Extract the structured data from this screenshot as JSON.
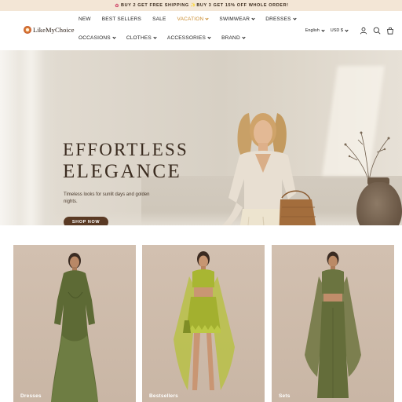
{
  "announcement": {
    "text": "BUY 2 GET FREE SHIPPING ✨BUY 3 GET 15% OFF WHOLE ORDER!",
    "icon": "gift-icon"
  },
  "brand": {
    "name": "LikeMyChoice",
    "logo_icon": "flower-logo-icon"
  },
  "nav": {
    "row1": [
      {
        "label": "NEW",
        "has_dropdown": false
      },
      {
        "label": "BEST SELLERS",
        "has_dropdown": false
      },
      {
        "label": "SALE",
        "has_dropdown": false
      },
      {
        "label": "VACATION",
        "has_dropdown": true,
        "active": true
      },
      {
        "label": "SWIMWEAR",
        "has_dropdown": true
      },
      {
        "label": "DRESSES",
        "has_dropdown": true
      }
    ],
    "row2": [
      {
        "label": "OCCASIONS",
        "has_dropdown": true
      },
      {
        "label": "CLOTHES",
        "has_dropdown": true
      },
      {
        "label": "ACCESSORIES",
        "has_dropdown": true
      },
      {
        "label": "BRAND",
        "has_dropdown": true
      }
    ]
  },
  "utility": {
    "language": "English",
    "currency": "USD $",
    "icons": [
      "account-icon",
      "search-icon",
      "cart-icon"
    ]
  },
  "hero": {
    "title_line1": "EFFORTLESS",
    "title_line2": "ELEGANCE",
    "subtitle": "Timeless looks for sunlit days and golden nights.",
    "cta_label": "SHOP NOW"
  },
  "categories": [
    {
      "label": "Dresses"
    },
    {
      "label": "Bestsellers"
    },
    {
      "label": "Sets"
    }
  ],
  "colors": {
    "accent": "#c98a2c",
    "cta_bg": "#5a3a24",
    "announce_bg": "#f3e6d6"
  }
}
